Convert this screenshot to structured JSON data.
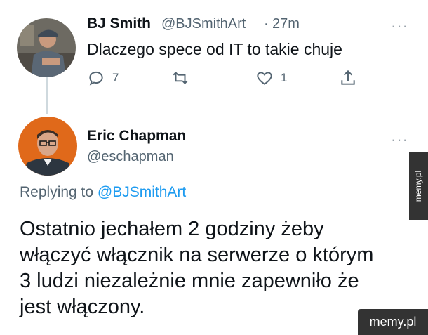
{
  "tweet1": {
    "author_name": "BJ Smith",
    "handle": "@BJSmithArt",
    "separator": "·",
    "time": "27m",
    "text": "Dlaczego spece od IT to takie chuje",
    "more": "···",
    "actions": {
      "reply": {
        "icon": "reply-icon",
        "count": "7"
      },
      "retweet": {
        "icon": "retweet-icon",
        "count": ""
      },
      "like": {
        "icon": "heart-icon",
        "count": "1"
      },
      "share": {
        "icon": "share-icon",
        "count": ""
      }
    }
  },
  "tweet2": {
    "author_name": "Eric Chapman",
    "handle": "@eschapman",
    "more": "···",
    "replying_prefix": "Replying to",
    "replying_to": "@BJSmithArt",
    "text_lines": [
      "Ostatnio jechałem 2 godziny żeby",
      "włączyć włącznik na serwerze o którym",
      "3 ludzi niezależnie mnie zapewniło że",
      "jest włączony."
    ]
  },
  "watermarks": {
    "side": "memy.pl",
    "corner": "memy.pl"
  },
  "colors": {
    "text": "#0f1419",
    "muted": "#536471",
    "link": "#1d9bf0",
    "watermark_bg": "#333333"
  }
}
